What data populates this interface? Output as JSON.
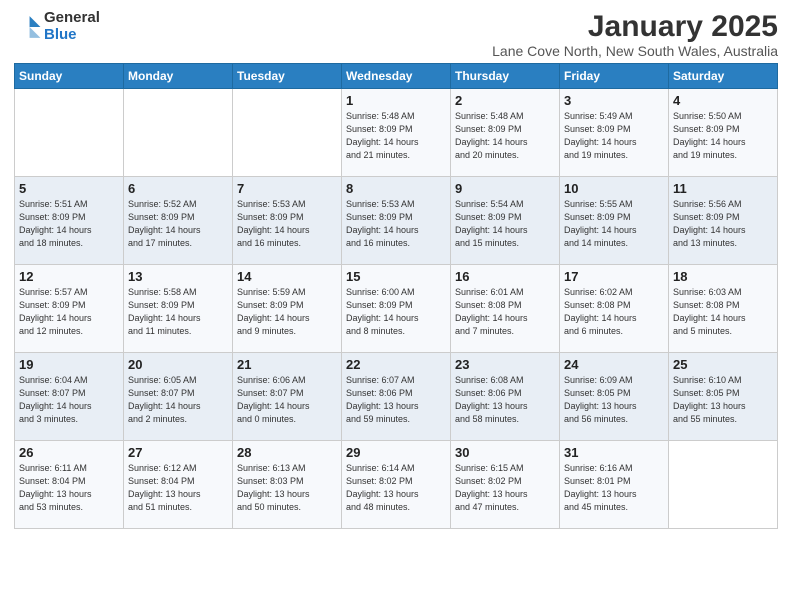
{
  "header": {
    "logo_general": "General",
    "logo_blue": "Blue",
    "month": "January 2025",
    "location": "Lane Cove North, New South Wales, Australia"
  },
  "weekdays": [
    "Sunday",
    "Monday",
    "Tuesday",
    "Wednesday",
    "Thursday",
    "Friday",
    "Saturday"
  ],
  "weeks": [
    [
      {
        "day": "",
        "info": ""
      },
      {
        "day": "",
        "info": ""
      },
      {
        "day": "",
        "info": ""
      },
      {
        "day": "1",
        "info": "Sunrise: 5:48 AM\nSunset: 8:09 PM\nDaylight: 14 hours\nand 21 minutes."
      },
      {
        "day": "2",
        "info": "Sunrise: 5:48 AM\nSunset: 8:09 PM\nDaylight: 14 hours\nand 20 minutes."
      },
      {
        "day": "3",
        "info": "Sunrise: 5:49 AM\nSunset: 8:09 PM\nDaylight: 14 hours\nand 19 minutes."
      },
      {
        "day": "4",
        "info": "Sunrise: 5:50 AM\nSunset: 8:09 PM\nDaylight: 14 hours\nand 19 minutes."
      }
    ],
    [
      {
        "day": "5",
        "info": "Sunrise: 5:51 AM\nSunset: 8:09 PM\nDaylight: 14 hours\nand 18 minutes."
      },
      {
        "day": "6",
        "info": "Sunrise: 5:52 AM\nSunset: 8:09 PM\nDaylight: 14 hours\nand 17 minutes."
      },
      {
        "day": "7",
        "info": "Sunrise: 5:53 AM\nSunset: 8:09 PM\nDaylight: 14 hours\nand 16 minutes."
      },
      {
        "day": "8",
        "info": "Sunrise: 5:53 AM\nSunset: 8:09 PM\nDaylight: 14 hours\nand 16 minutes."
      },
      {
        "day": "9",
        "info": "Sunrise: 5:54 AM\nSunset: 8:09 PM\nDaylight: 14 hours\nand 15 minutes."
      },
      {
        "day": "10",
        "info": "Sunrise: 5:55 AM\nSunset: 8:09 PM\nDaylight: 14 hours\nand 14 minutes."
      },
      {
        "day": "11",
        "info": "Sunrise: 5:56 AM\nSunset: 8:09 PM\nDaylight: 14 hours\nand 13 minutes."
      }
    ],
    [
      {
        "day": "12",
        "info": "Sunrise: 5:57 AM\nSunset: 8:09 PM\nDaylight: 14 hours\nand 12 minutes."
      },
      {
        "day": "13",
        "info": "Sunrise: 5:58 AM\nSunset: 8:09 PM\nDaylight: 14 hours\nand 11 minutes."
      },
      {
        "day": "14",
        "info": "Sunrise: 5:59 AM\nSunset: 8:09 PM\nDaylight: 14 hours\nand 9 minutes."
      },
      {
        "day": "15",
        "info": "Sunrise: 6:00 AM\nSunset: 8:09 PM\nDaylight: 14 hours\nand 8 minutes."
      },
      {
        "day": "16",
        "info": "Sunrise: 6:01 AM\nSunset: 8:08 PM\nDaylight: 14 hours\nand 7 minutes."
      },
      {
        "day": "17",
        "info": "Sunrise: 6:02 AM\nSunset: 8:08 PM\nDaylight: 14 hours\nand 6 minutes."
      },
      {
        "day": "18",
        "info": "Sunrise: 6:03 AM\nSunset: 8:08 PM\nDaylight: 14 hours\nand 5 minutes."
      }
    ],
    [
      {
        "day": "19",
        "info": "Sunrise: 6:04 AM\nSunset: 8:07 PM\nDaylight: 14 hours\nand 3 minutes."
      },
      {
        "day": "20",
        "info": "Sunrise: 6:05 AM\nSunset: 8:07 PM\nDaylight: 14 hours\nand 2 minutes."
      },
      {
        "day": "21",
        "info": "Sunrise: 6:06 AM\nSunset: 8:07 PM\nDaylight: 14 hours\nand 0 minutes."
      },
      {
        "day": "22",
        "info": "Sunrise: 6:07 AM\nSunset: 8:06 PM\nDaylight: 13 hours\nand 59 minutes."
      },
      {
        "day": "23",
        "info": "Sunrise: 6:08 AM\nSunset: 8:06 PM\nDaylight: 13 hours\nand 58 minutes."
      },
      {
        "day": "24",
        "info": "Sunrise: 6:09 AM\nSunset: 8:05 PM\nDaylight: 13 hours\nand 56 minutes."
      },
      {
        "day": "25",
        "info": "Sunrise: 6:10 AM\nSunset: 8:05 PM\nDaylight: 13 hours\nand 55 minutes."
      }
    ],
    [
      {
        "day": "26",
        "info": "Sunrise: 6:11 AM\nSunset: 8:04 PM\nDaylight: 13 hours\nand 53 minutes."
      },
      {
        "day": "27",
        "info": "Sunrise: 6:12 AM\nSunset: 8:04 PM\nDaylight: 13 hours\nand 51 minutes."
      },
      {
        "day": "28",
        "info": "Sunrise: 6:13 AM\nSunset: 8:03 PM\nDaylight: 13 hours\nand 50 minutes."
      },
      {
        "day": "29",
        "info": "Sunrise: 6:14 AM\nSunset: 8:02 PM\nDaylight: 13 hours\nand 48 minutes."
      },
      {
        "day": "30",
        "info": "Sunrise: 6:15 AM\nSunset: 8:02 PM\nDaylight: 13 hours\nand 47 minutes."
      },
      {
        "day": "31",
        "info": "Sunrise: 6:16 AM\nSunset: 8:01 PM\nDaylight: 13 hours\nand 45 minutes."
      },
      {
        "day": "",
        "info": ""
      }
    ]
  ]
}
